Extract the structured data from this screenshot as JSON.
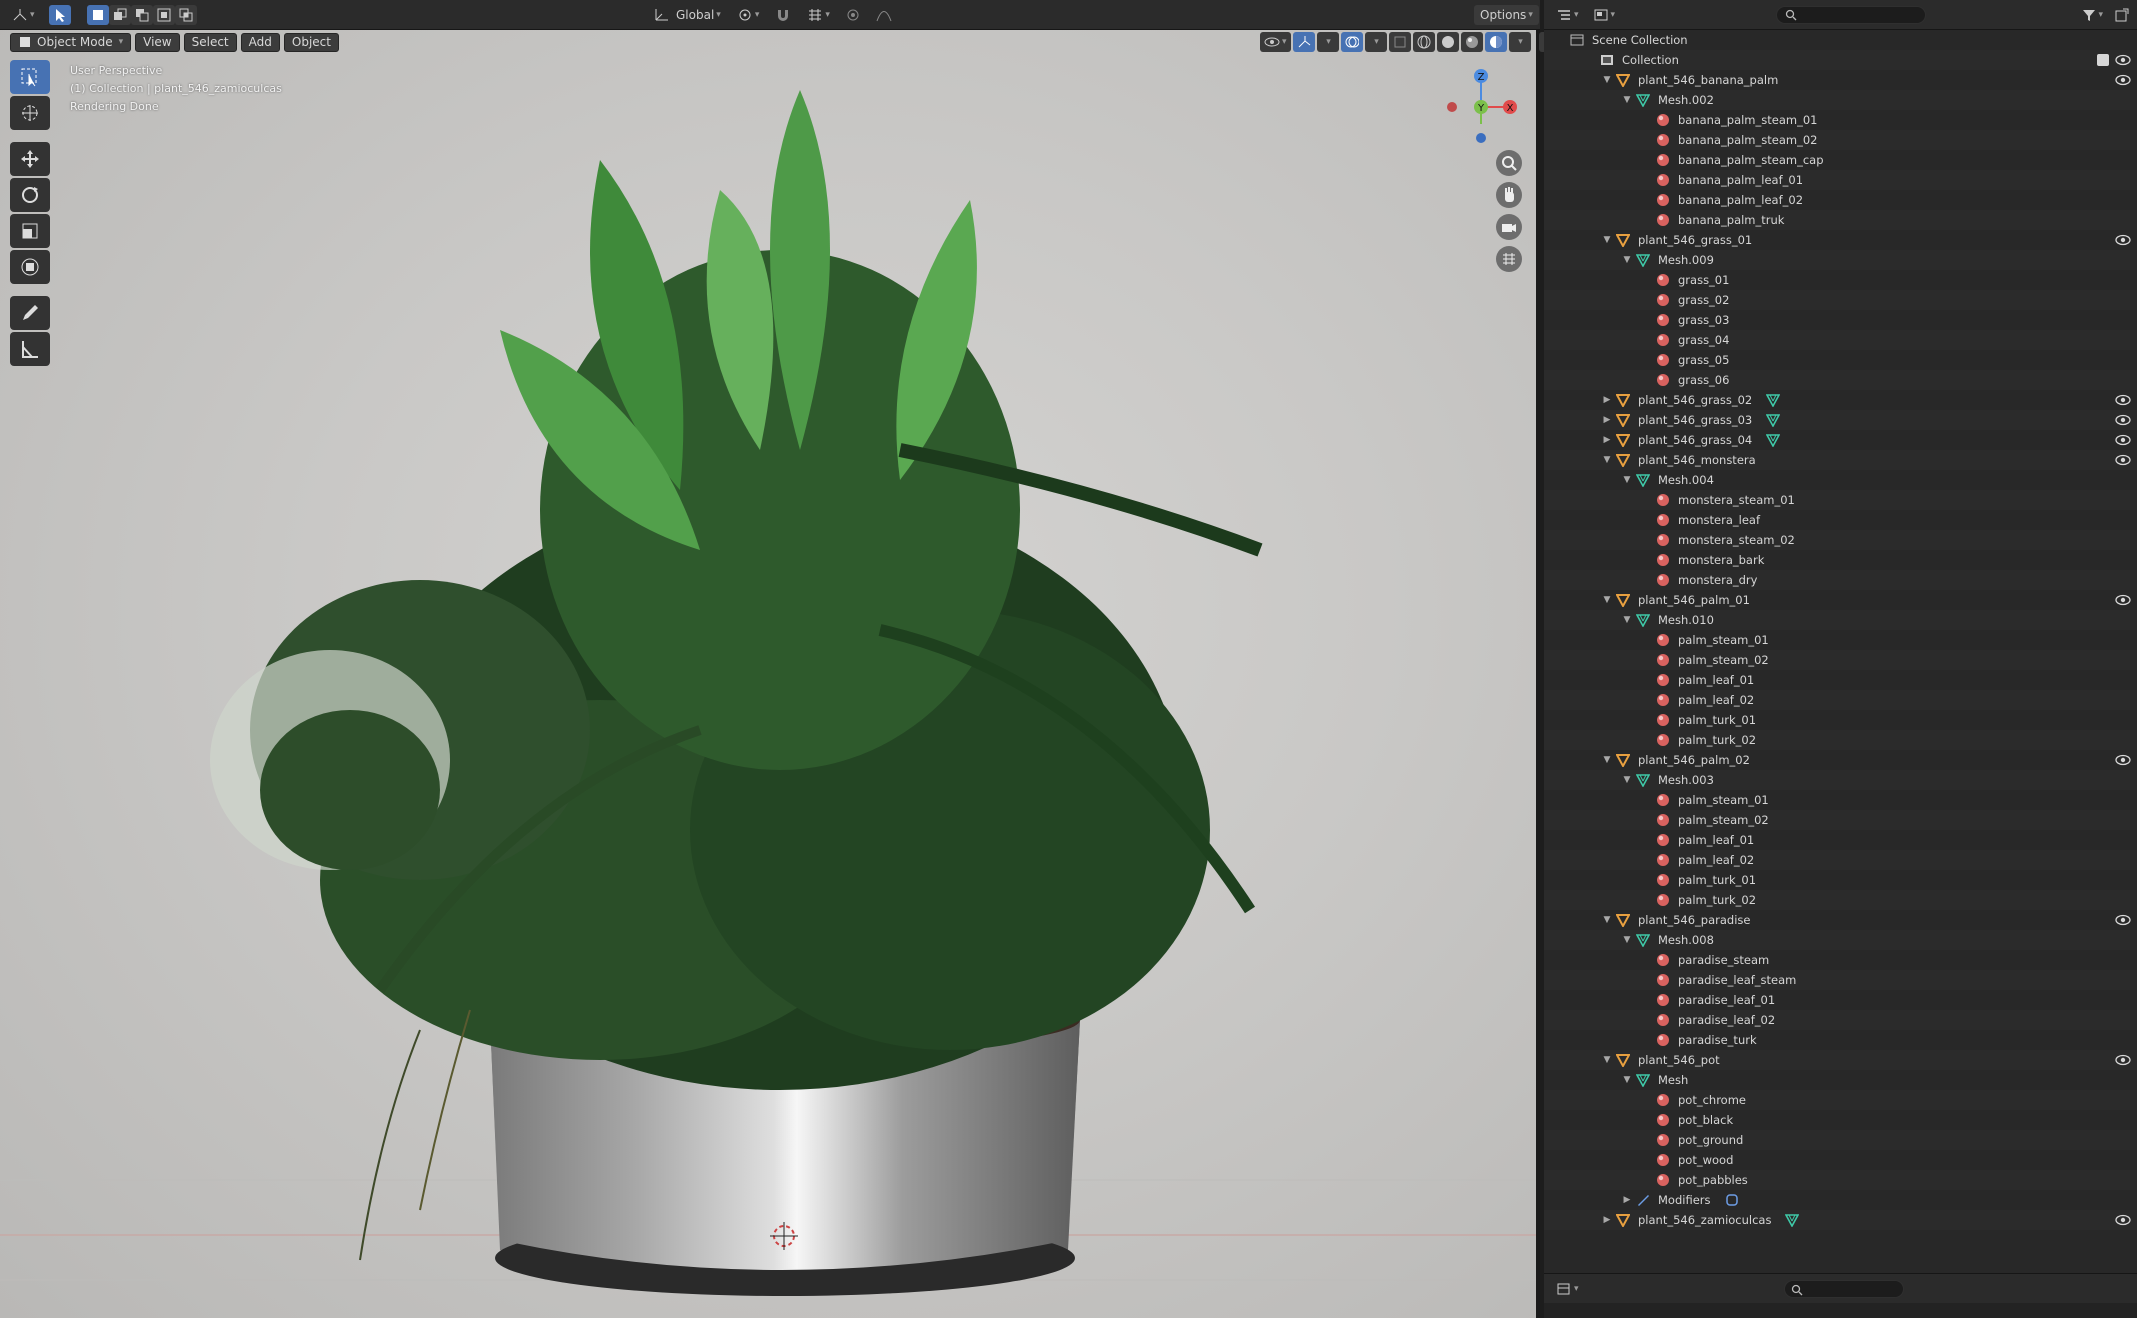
{
  "header": {
    "transform_orientation": "Global",
    "options_label": "Options"
  },
  "menubar": {
    "mode": "Object Mode",
    "view": "View",
    "select": "Select",
    "add": "Add",
    "object": "Object"
  },
  "viewport_info": {
    "line1": "User Perspective",
    "line2": "(1) Collection | plant_546_zamioculcas",
    "line3": "Rendering Done"
  },
  "gizmo": {
    "x": "X",
    "y": "Y",
    "z": "Z"
  },
  "colors": {
    "accent": "#4772b3",
    "object_icon": "#e8a040",
    "mesh_icon": "#3fc9a8",
    "material_icon": "#d9625f",
    "modifier_icon": "#6d9de6"
  },
  "outliner": {
    "scene_collection": "Scene Collection",
    "rows": [
      {
        "depth": 0,
        "exp": "",
        "icon": "collection",
        "label": "Collection",
        "eye": true,
        "check": true
      },
      {
        "depth": 1,
        "exp": "▼",
        "icon": "object",
        "label": "plant_546_banana_palm",
        "eye": true
      },
      {
        "depth": 2,
        "exp": "▼",
        "icon": "mesh",
        "label": "Mesh.002"
      },
      {
        "depth": 3,
        "exp": "",
        "icon": "material",
        "label": "banana_palm_steam_01"
      },
      {
        "depth": 3,
        "exp": "",
        "icon": "material",
        "label": "banana_palm_steam_02"
      },
      {
        "depth": 3,
        "exp": "",
        "icon": "material",
        "label": "banana_palm_steam_cap"
      },
      {
        "depth": 3,
        "exp": "",
        "icon": "material",
        "label": "banana_palm_leaf_01"
      },
      {
        "depth": 3,
        "exp": "",
        "icon": "material",
        "label": "banana_palm_leaf_02"
      },
      {
        "depth": 3,
        "exp": "",
        "icon": "material",
        "label": "banana_palm_truk"
      },
      {
        "depth": 1,
        "exp": "▼",
        "icon": "object",
        "label": "plant_546_grass_01",
        "eye": true
      },
      {
        "depth": 2,
        "exp": "▼",
        "icon": "mesh",
        "label": "Mesh.009"
      },
      {
        "depth": 3,
        "exp": "",
        "icon": "material",
        "label": "grass_01"
      },
      {
        "depth": 3,
        "exp": "",
        "icon": "material",
        "label": "grass_02"
      },
      {
        "depth": 3,
        "exp": "",
        "icon": "material",
        "label": "grass_03"
      },
      {
        "depth": 3,
        "exp": "",
        "icon": "material",
        "label": "grass_04"
      },
      {
        "depth": 3,
        "exp": "",
        "icon": "material",
        "label": "grass_05"
      },
      {
        "depth": 3,
        "exp": "",
        "icon": "material",
        "label": "grass_06"
      },
      {
        "depth": 1,
        "exp": "▶",
        "icon": "object",
        "label": "plant_546_grass_02",
        "eye": true,
        "extra": "mesh"
      },
      {
        "depth": 1,
        "exp": "▶",
        "icon": "object",
        "label": "plant_546_grass_03",
        "eye": true,
        "extra": "mesh"
      },
      {
        "depth": 1,
        "exp": "▶",
        "icon": "object",
        "label": "plant_546_grass_04",
        "eye": true,
        "extra": "mesh"
      },
      {
        "depth": 1,
        "exp": "▼",
        "icon": "object",
        "label": "plant_546_monstera",
        "eye": true
      },
      {
        "depth": 2,
        "exp": "▼",
        "icon": "mesh",
        "label": "Mesh.004"
      },
      {
        "depth": 3,
        "exp": "",
        "icon": "material",
        "label": "monstera_steam_01"
      },
      {
        "depth": 3,
        "exp": "",
        "icon": "material",
        "label": "monstera_leaf"
      },
      {
        "depth": 3,
        "exp": "",
        "icon": "material",
        "label": "monstera_steam_02"
      },
      {
        "depth": 3,
        "exp": "",
        "icon": "material",
        "label": "monstera_bark"
      },
      {
        "depth": 3,
        "exp": "",
        "icon": "material",
        "label": "monstera_dry"
      },
      {
        "depth": 1,
        "exp": "▼",
        "icon": "object",
        "label": "plant_546_palm_01",
        "eye": true
      },
      {
        "depth": 2,
        "exp": "▼",
        "icon": "mesh",
        "label": "Mesh.010"
      },
      {
        "depth": 3,
        "exp": "",
        "icon": "material",
        "label": "palm_steam_01"
      },
      {
        "depth": 3,
        "exp": "",
        "icon": "material",
        "label": "palm_steam_02"
      },
      {
        "depth": 3,
        "exp": "",
        "icon": "material",
        "label": "palm_leaf_01"
      },
      {
        "depth": 3,
        "exp": "",
        "icon": "material",
        "label": "palm_leaf_02"
      },
      {
        "depth": 3,
        "exp": "",
        "icon": "material",
        "label": "palm_turk_01"
      },
      {
        "depth": 3,
        "exp": "",
        "icon": "material",
        "label": "palm_turk_02"
      },
      {
        "depth": 1,
        "exp": "▼",
        "icon": "object",
        "label": "plant_546_palm_02",
        "eye": true
      },
      {
        "depth": 2,
        "exp": "▼",
        "icon": "mesh",
        "label": "Mesh.003"
      },
      {
        "depth": 3,
        "exp": "",
        "icon": "material",
        "label": "palm_steam_01"
      },
      {
        "depth": 3,
        "exp": "",
        "icon": "material",
        "label": "palm_steam_02"
      },
      {
        "depth": 3,
        "exp": "",
        "icon": "material",
        "label": "palm_leaf_01"
      },
      {
        "depth": 3,
        "exp": "",
        "icon": "material",
        "label": "palm_leaf_02"
      },
      {
        "depth": 3,
        "exp": "",
        "icon": "material",
        "label": "palm_turk_01"
      },
      {
        "depth": 3,
        "exp": "",
        "icon": "material",
        "label": "palm_turk_02"
      },
      {
        "depth": 1,
        "exp": "▼",
        "icon": "object",
        "label": "plant_546_paradise",
        "eye": true
      },
      {
        "depth": 2,
        "exp": "▼",
        "icon": "mesh",
        "label": "Mesh.008"
      },
      {
        "depth": 3,
        "exp": "",
        "icon": "material",
        "label": "paradise_steam"
      },
      {
        "depth": 3,
        "exp": "",
        "icon": "material",
        "label": "paradise_leaf_steam"
      },
      {
        "depth": 3,
        "exp": "",
        "icon": "material",
        "label": "paradise_leaf_01"
      },
      {
        "depth": 3,
        "exp": "",
        "icon": "material",
        "label": "paradise_leaf_02"
      },
      {
        "depth": 3,
        "exp": "",
        "icon": "material",
        "label": "paradise_turk"
      },
      {
        "depth": 1,
        "exp": "▼",
        "icon": "object",
        "label": "plant_546_pot",
        "eye": true
      },
      {
        "depth": 2,
        "exp": "▼",
        "icon": "mesh",
        "label": "Mesh"
      },
      {
        "depth": 3,
        "exp": "",
        "icon": "material",
        "label": "pot_chrome"
      },
      {
        "depth": 3,
        "exp": "",
        "icon": "material",
        "label": "pot_black"
      },
      {
        "depth": 3,
        "exp": "",
        "icon": "material",
        "label": "pot_ground"
      },
      {
        "depth": 3,
        "exp": "",
        "icon": "material",
        "label": "pot_wood"
      },
      {
        "depth": 3,
        "exp": "",
        "icon": "material",
        "label": "pot_pabbles"
      },
      {
        "depth": 2,
        "exp": "▶",
        "icon": "modifier",
        "label": "Modifiers",
        "extra": "modifier-sub"
      },
      {
        "depth": 1,
        "exp": "▶",
        "icon": "object",
        "label": "plant_546_zamioculcas",
        "eye": true,
        "extra": "mesh"
      }
    ]
  }
}
